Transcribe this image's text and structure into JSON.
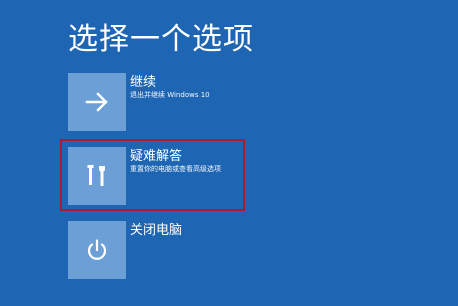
{
  "page": {
    "title": "选择一个选项"
  },
  "options": [
    {
      "label": "继续",
      "description": "退出并继续 Windows 10",
      "icon": "arrow-right-icon"
    },
    {
      "label": "疑难解答",
      "description": "重置你的电脑或查看高级选项",
      "icon": "tools-icon"
    },
    {
      "label": "关闭电脑",
      "description": "",
      "icon": "power-icon"
    }
  ],
  "colors": {
    "background": "#1e66b4",
    "tile": "#6b9fd6",
    "highlight": "#b01830",
    "text": "#ffffff"
  }
}
